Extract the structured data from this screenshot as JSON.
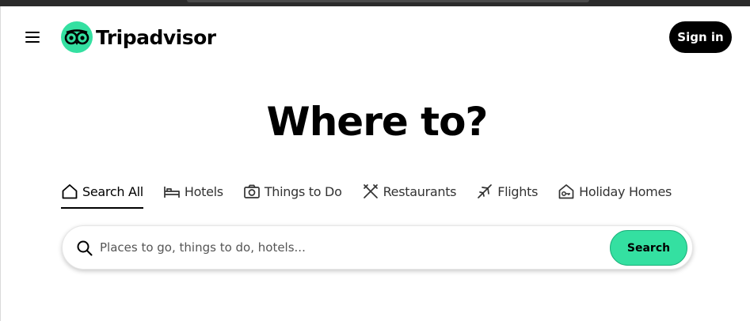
{
  "header": {
    "menu_icon": "hamburger-menu-icon",
    "logo_icon": "tripadvisor-owl-icon",
    "logo_text": "Tripadvisor",
    "signin_label": "Sign in"
  },
  "hero": {
    "heading": "Where to?"
  },
  "tabs": [
    {
      "label": "Search All",
      "icon": "home-icon",
      "active": true
    },
    {
      "label": "Hotels",
      "icon": "bed-icon",
      "active": false
    },
    {
      "label": "Things to Do",
      "icon": "camera-icon",
      "active": false
    },
    {
      "label": "Restaurants",
      "icon": "fork-knife-icon",
      "active": false
    },
    {
      "label": "Flights",
      "icon": "airplane-icon",
      "active": false
    },
    {
      "label": "Holiday Homes",
      "icon": "house-key-icon",
      "active": false
    }
  ],
  "search": {
    "placeholder": "Places to go, things to do, hotels...",
    "value": "",
    "button_label": "Search",
    "icon": "search-icon"
  },
  "colors": {
    "brand_green": "#34e0a1",
    "signin_bg": "#000000",
    "text_primary": "#000000"
  }
}
